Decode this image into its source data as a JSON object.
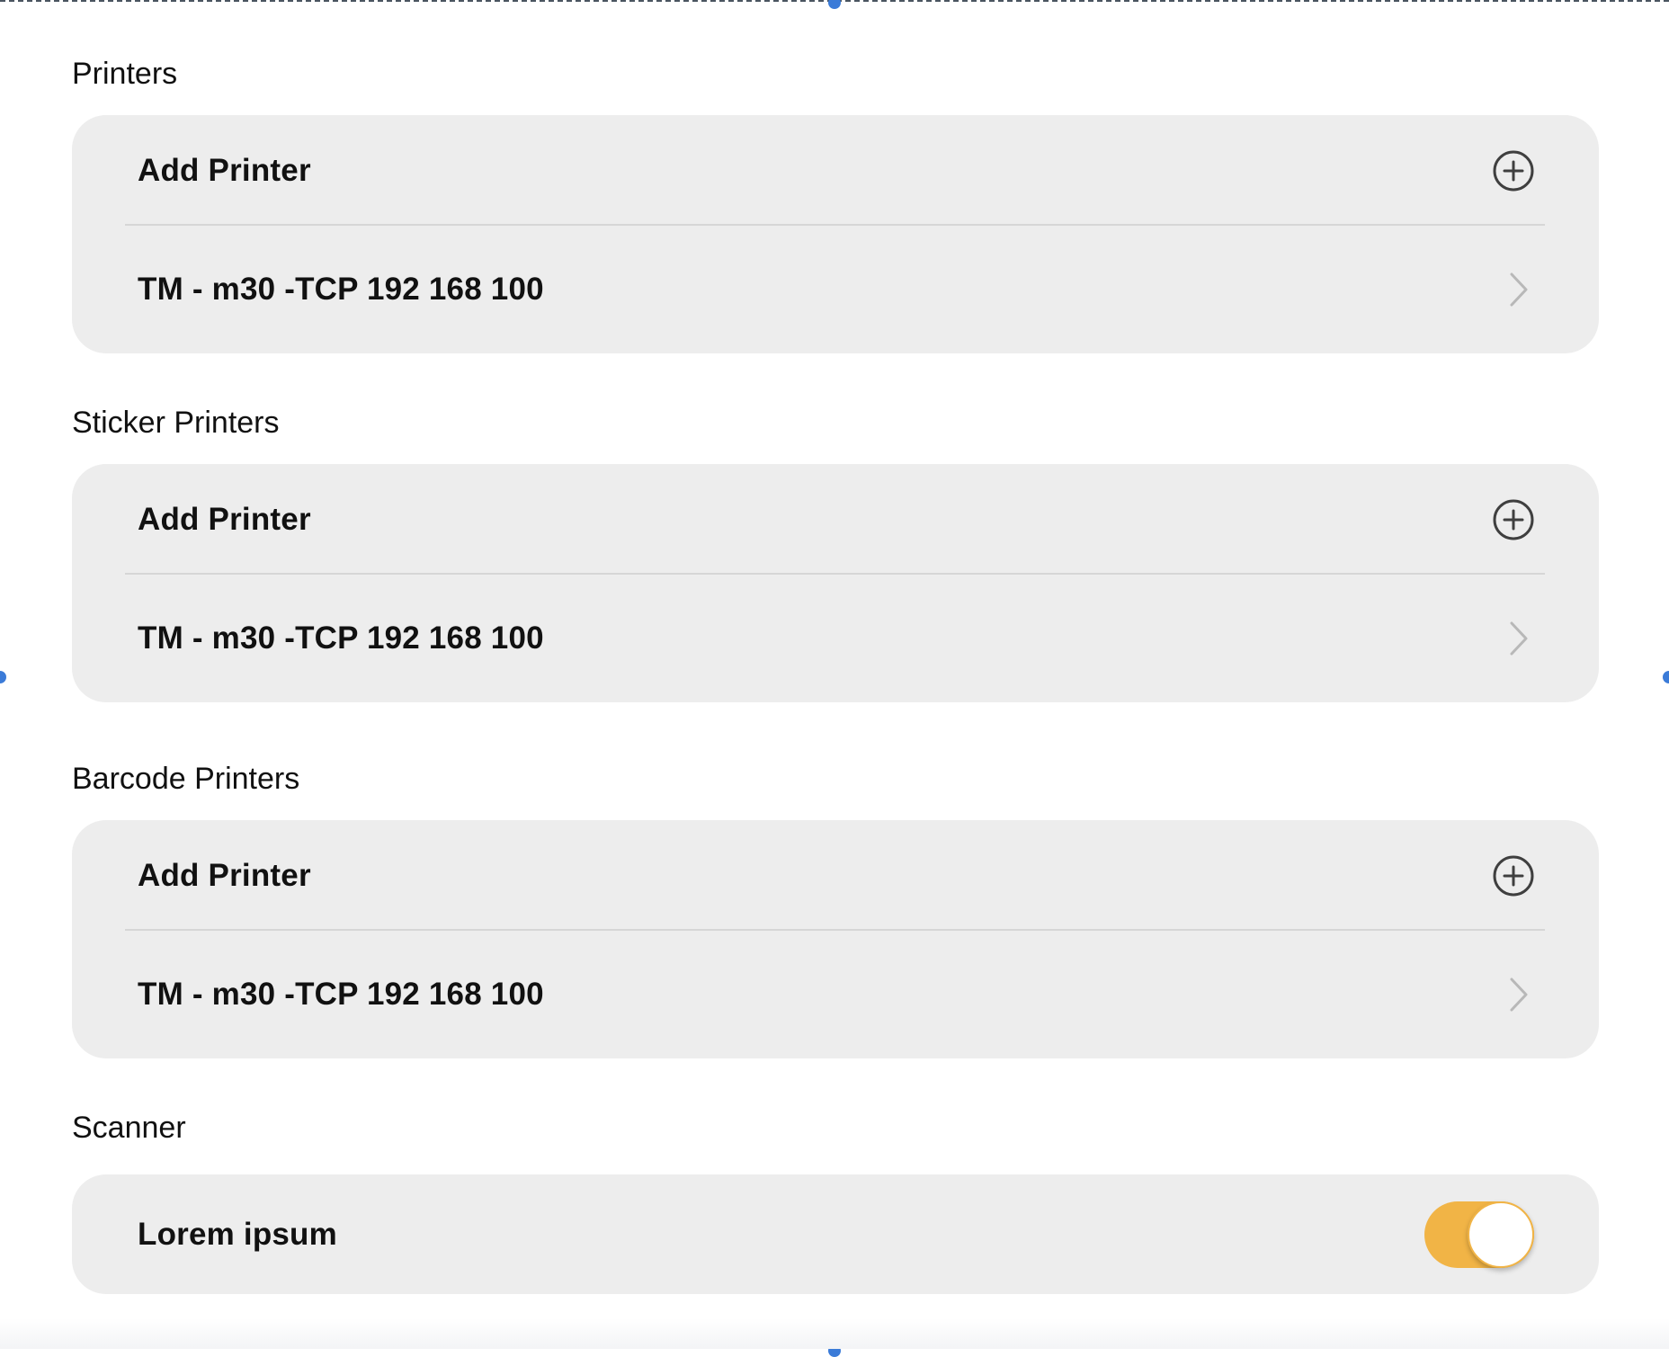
{
  "sections": [
    {
      "title": "Printers",
      "add_label": "Add Printer",
      "device_label": "TM - m30 -TCP 192 168 100"
    },
    {
      "title": "Sticker Printers",
      "add_label": "Add Printer",
      "device_label": "TM - m30 -TCP 192 168 100"
    },
    {
      "title": "Barcode Printers",
      "add_label": "Add Printer",
      "device_label": "TM - m30 -TCP 192 168 100"
    }
  ],
  "scanner": {
    "title": "Scanner",
    "option_label": "Lorem ipsum",
    "toggle_on": true
  },
  "colors": {
    "card_background": "#ededed",
    "toggle_accent": "#f1b446",
    "selection_handle": "#3b7bd8"
  },
  "icons": {
    "add": "plus-circle-icon",
    "navigate": "chevron-right-icon"
  }
}
